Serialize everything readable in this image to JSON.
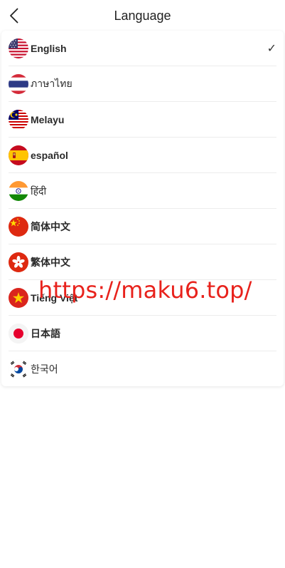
{
  "header": {
    "title": "Language",
    "back_icon": "chevron-left-icon"
  },
  "languages": [
    {
      "id": "english",
      "label": "English",
      "flag": "us-flag-icon",
      "selected": true,
      "bold": true
    },
    {
      "id": "thai",
      "label": "ภาษาไทย",
      "flag": "thailand-flag-icon",
      "selected": false,
      "bold": false
    },
    {
      "id": "melayu",
      "label": "Melayu",
      "flag": "malaysia-flag-icon",
      "selected": false,
      "bold": true
    },
    {
      "id": "espanol",
      "label": "español",
      "flag": "spain-flag-icon",
      "selected": false,
      "bold": true
    },
    {
      "id": "hindi",
      "label": "हिंदी",
      "flag": "india-flag-icon",
      "selected": false,
      "bold": false
    },
    {
      "id": "zh-hans",
      "label": "简体中文",
      "flag": "china-flag-icon",
      "selected": false,
      "bold": true
    },
    {
      "id": "zh-hant",
      "label": "繁体中文",
      "flag": "hong-kong-flag-icon",
      "selected": false,
      "bold": true
    },
    {
      "id": "vietnamese",
      "label": "Tiếng Việt",
      "flag": "vietnam-flag-icon",
      "selected": false,
      "bold": true
    },
    {
      "id": "japanese",
      "label": "日本語",
      "flag": "japan-flag-icon",
      "selected": false,
      "bold": true
    },
    {
      "id": "korean",
      "label": "한국어",
      "flag": "korea-flag-icon",
      "selected": false,
      "bold": false
    }
  ],
  "selected_mark": "✓",
  "watermark": "https://maku6.top/",
  "colors": {
    "watermark": "#e8221c",
    "divider": "#ececec",
    "text": "#2a2a2a"
  }
}
